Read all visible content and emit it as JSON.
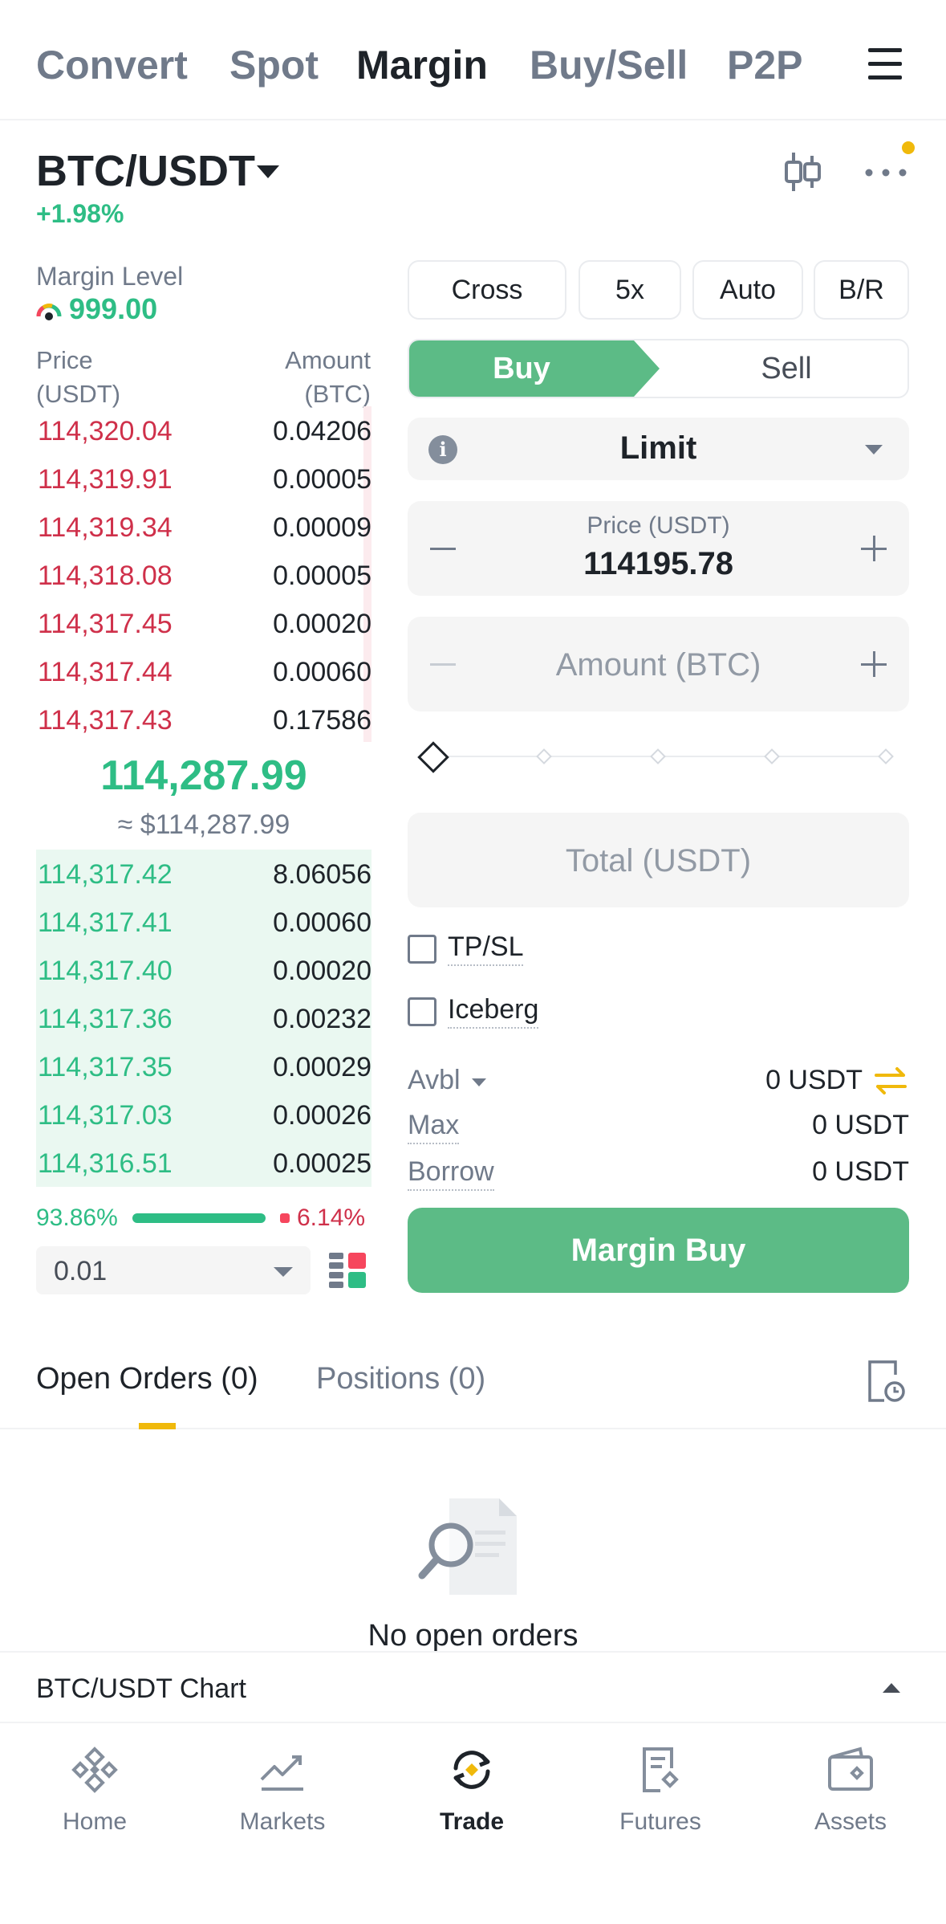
{
  "top_tabs": [
    "Convert",
    "Spot",
    "Margin",
    "Buy/Sell",
    "P2P"
  ],
  "active_tab": "Margin",
  "pair": {
    "symbol": "BTC/USDT",
    "change": "+1.98%"
  },
  "margin_level": {
    "label": "Margin Level",
    "value": "999.00"
  },
  "order_book": {
    "price_header": [
      "Price",
      "(USDT)"
    ],
    "amount_header": [
      "Amount",
      "(BTC)"
    ],
    "asks": [
      {
        "price": "114,320.04",
        "amount": "0.04206"
      },
      {
        "price": "114,319.91",
        "amount": "0.00005"
      },
      {
        "price": "114,319.34",
        "amount": "0.00009"
      },
      {
        "price": "114,318.08",
        "amount": "0.00005"
      },
      {
        "price": "114,317.45",
        "amount": "0.00020"
      },
      {
        "price": "114,317.44",
        "amount": "0.00060"
      },
      {
        "price": "114,317.43",
        "amount": "0.17586"
      }
    ],
    "last_price": "114,287.99",
    "last_price_usd": "≈ $114,287.99",
    "bids": [
      {
        "price": "114,317.42",
        "amount": "8.06056"
      },
      {
        "price": "114,317.41",
        "amount": "0.00060"
      },
      {
        "price": "114,317.40",
        "amount": "0.00020"
      },
      {
        "price": "114,317.36",
        "amount": "0.00232"
      },
      {
        "price": "114,317.35",
        "amount": "0.00029"
      },
      {
        "price": "114,317.03",
        "amount": "0.00026"
      },
      {
        "price": "114,316.51",
        "amount": "0.00025"
      }
    ],
    "buy_ratio": "93.86%",
    "sell_ratio": "6.14%",
    "buy_ratio_value": 93.86,
    "depth": "0.01"
  },
  "order_form": {
    "mode_pills": [
      "Cross",
      "5x",
      "Auto",
      "B/R"
    ],
    "buy_label": "Buy",
    "sell_label": "Sell",
    "order_type": "Limit",
    "price_label": "Price (USDT)",
    "price_value": "114195.78",
    "amount_label": "Amount (BTC)",
    "total_label": "Total (USDT)",
    "tpsl_label": "TP/SL",
    "iceberg_label": "Iceberg",
    "avbl_label": "Avbl",
    "avbl_value": "0 USDT",
    "max_label": "Max",
    "max_value": "0 USDT",
    "borrow_label": "Borrow",
    "borrow_value": "0 USDT",
    "submit_label": "Margin Buy"
  },
  "orders": {
    "tabs": [
      "Open Orders (0)",
      "Positions (0)"
    ],
    "empty_text": "No open orders"
  },
  "chart_bar_label": "BTC/USDT Chart",
  "bottom_nav": [
    "Home",
    "Markets",
    "Trade",
    "Futures",
    "Assets"
  ],
  "colors": {
    "green": "#2ebd85",
    "red": "#cf304a",
    "buy_button": "#5cbb86",
    "accent": "#f0b90b"
  }
}
